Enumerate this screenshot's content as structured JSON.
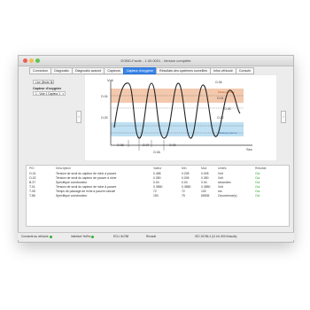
{
  "window": {
    "title": "EOBD-Facile - 1.00.0001 - Version complète"
  },
  "tabs": [
    {
      "label": "Connexion"
    },
    {
      "label": "Diagnostic"
    },
    {
      "label": "Diagnostic avancé"
    },
    {
      "label": "Capteurs"
    },
    {
      "label": "Capteur d'oxygène",
      "active": true
    },
    {
      "label": "Résultats des systèmes surveillés"
    },
    {
      "label": "Infos véhicule"
    },
    {
      "label": "Console"
    }
  ],
  "left_panel": {
    "mode_value": "Live (Mode 3)",
    "sensor_label": "Capteur d'oxygène",
    "sensor_value": "1 : Voie 1 Capteur 1"
  },
  "chart": {
    "y_unit": "Volt",
    "x_unit": "Sec",
    "rich_label": "Mélange riche",
    "lean_label": "Mélange pauvre",
    "labels": [
      "O-08",
      "O-04",
      "O-03",
      "O-01",
      "O-02",
      "O-05",
      "O-06",
      "O-07",
      "O-09",
      "O-0A"
    ],
    "colors": {
      "rich": "#f3c9ae",
      "lean": "#bfe0f3",
      "curve": "#222222",
      "accent": "#3b86e8"
    }
  },
  "table": {
    "headers": [
      "PID",
      "Description",
      "Valeur",
      "Min",
      "Max",
      "Unités",
      "Résultat"
    ],
    "rows": [
      [
        "O-01",
        "Tension de seuil du capteur de riche à pauvre",
        "0.458",
        "0.205",
        "0.005",
        "Volt",
        "Oui"
      ],
      [
        "O-02",
        "Tension de seuil du capteur de pauvre à riche",
        "0.350",
        "0.005",
        "0.350",
        "Volt",
        "Oui"
      ],
      [
        "B-37",
        "Spécifique constructeur",
        "0.04",
        "0.04",
        "0.04",
        "secondes",
        "Oui"
      ],
      [
        "T-01",
        "Tension de seuil du capteur de riche à pauvre",
        "0.3850",
        "0.3850",
        "0.3850",
        "Volt",
        "Oui"
      ],
      [
        "T-05",
        "Temps de passage de riche à pauvre calculé",
        "72",
        "72",
        "100",
        "ms",
        "Oui"
      ],
      [
        "T-86",
        "Spécifique constructeur",
        "150",
        "75",
        "65535",
        "Occurrence(s)",
        "Oui"
      ]
    ]
  },
  "status": {
    "connection": "Connecté au véhicule",
    "interface": "Interface %d%s",
    "ecu": "ECU: 8x758",
    "brand": "Renault",
    "protocol": "ISO 15765-4 (11 bit, 500 Kbauds)"
  }
}
